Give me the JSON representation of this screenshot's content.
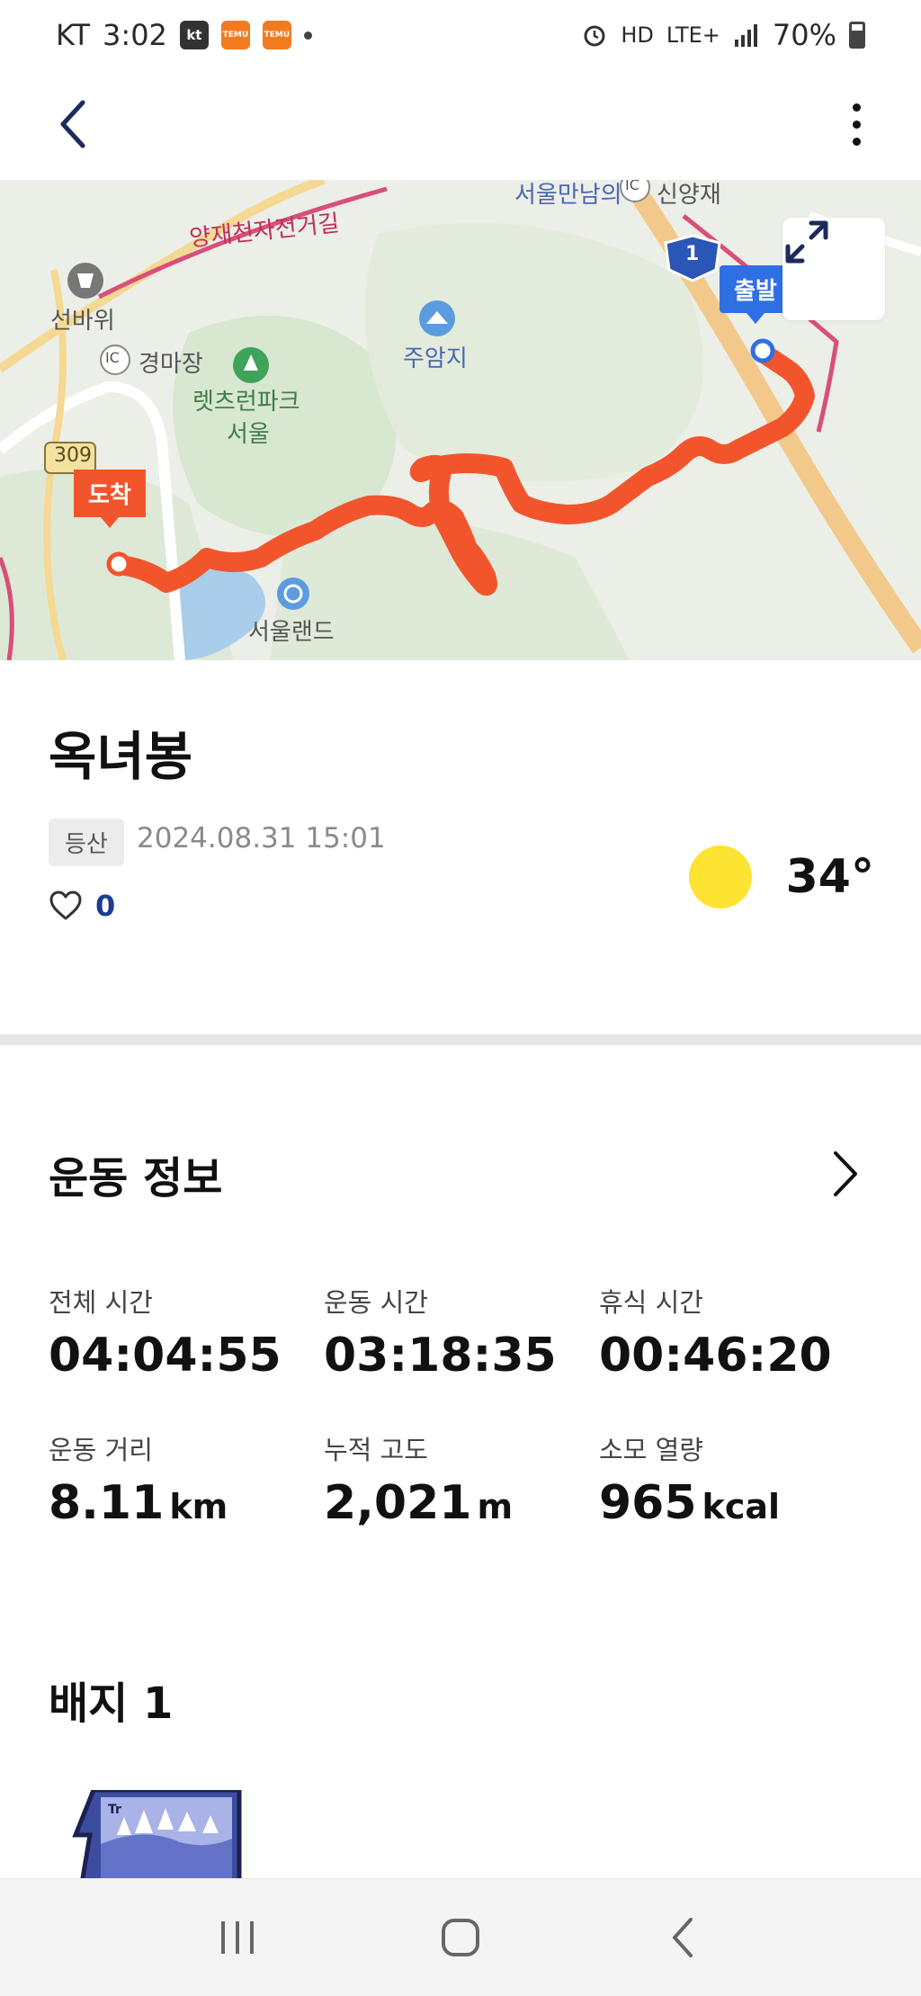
{
  "status_bar": {
    "carrier": "KT",
    "time": "3:02",
    "kt_badge": "kt",
    "temu_badge": "TEMU",
    "network": "LTE+",
    "hd": "HD",
    "battery": "70%"
  },
  "map": {
    "labels": {
      "road_top": "양재천자전거길",
      "highway_top": "서울만남의",
      "place_top_right": "신양재",
      "seonbawi": "선바위",
      "gyeongmajang": "경마장",
      "park_line1": "렛츠런파크",
      "park_line2": "서울",
      "juamji": "주암지",
      "seoulland": "서울랜드",
      "route_309": "309",
      "route_1": "1",
      "ic1": "IC",
      "ic2": "IC"
    },
    "start_marker": "출발",
    "end_marker": "도착",
    "colors": {
      "route": "#f2552c",
      "start": "#2f6fe4",
      "end": "#f2552c"
    }
  },
  "activity": {
    "title": "옥녀봉",
    "category": "등산",
    "datetime": "2024.08.31 15:01",
    "likes": "0",
    "temperature": "34°"
  },
  "exercise_info": {
    "title": "운동 정보",
    "stats": [
      {
        "label": "전체 시간",
        "value": "04:04:55",
        "unit": ""
      },
      {
        "label": "운동 시간",
        "value": "03:18:35",
        "unit": ""
      },
      {
        "label": "휴식 시간",
        "value": "00:46:20",
        "unit": ""
      },
      {
        "label": "운동 거리",
        "value": "8.11",
        "unit": "km"
      },
      {
        "label": "누적 고도",
        "value": "2,021",
        "unit": "m"
      },
      {
        "label": "소모 열량",
        "value": "965",
        "unit": "kcal"
      }
    ]
  },
  "badges": {
    "title": "배지 1"
  }
}
